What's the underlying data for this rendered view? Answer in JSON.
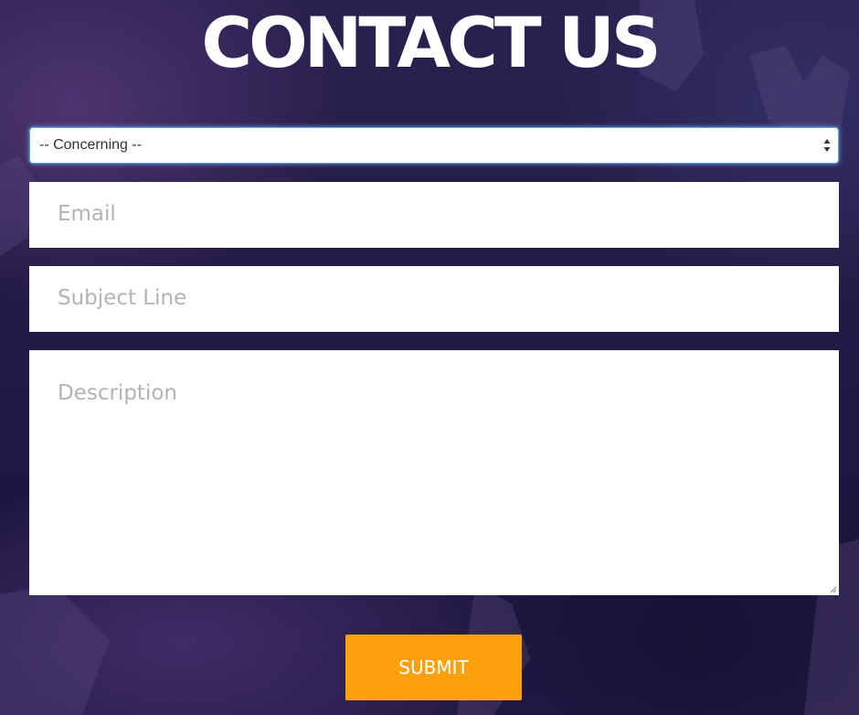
{
  "page": {
    "title": "CONTACT US"
  },
  "form": {
    "concerning_select": {
      "selected": "-- Concerning --"
    },
    "email": {
      "placeholder": "Email",
      "value": ""
    },
    "subject": {
      "placeholder": "Subject Line",
      "value": ""
    },
    "description": {
      "placeholder": "Description",
      "value": ""
    },
    "submit_label": "SUBMIT"
  },
  "colors": {
    "background": "#241a44",
    "submit_button": "#fca00b",
    "focus_outline": "#5aa0e6",
    "placeholder_text": "#b3b3b3"
  },
  "icons": {
    "select_arrows": "up-down-arrows-icon",
    "resize": "resize-handle-icon"
  }
}
